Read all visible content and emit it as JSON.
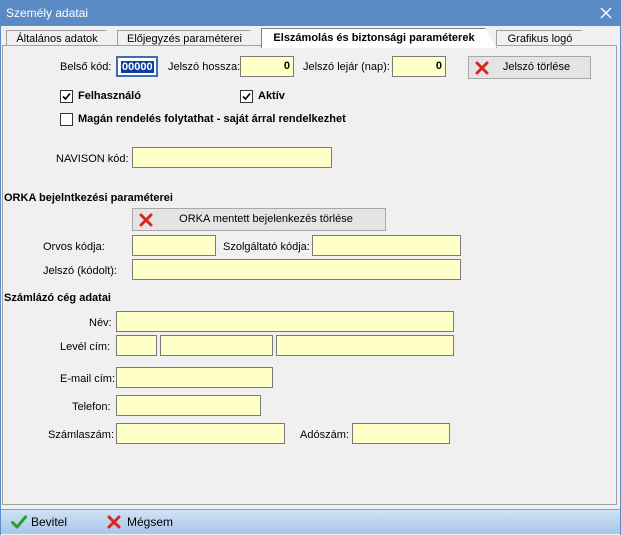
{
  "window": {
    "title": "Személy adatai"
  },
  "tabs": [
    {
      "label": "Általános adatok"
    },
    {
      "label": "Előjegyzés paraméterei"
    },
    {
      "label": "Elszámolás és biztonsági paraméterek"
    },
    {
      "label": "Grafikus logó"
    }
  ],
  "security": {
    "belso_kod_label": "Belső kód:",
    "belso_kod_value": "00000",
    "jelszo_hossza_label": "Jelszó hossza:",
    "jelszo_hossza_value": "0",
    "jelszo_lejar_label": "Jelszó lejár (nap):",
    "jelszo_lejar_value": "0",
    "jelszo_torlese_label": "Jelszó törlése",
    "felhasznalo_label": "Felhasználó",
    "felhasznalo_checked": true,
    "aktiv_label": "Aktív",
    "aktiv_checked": true,
    "magan_label": "Magán rendelés folytathat - saját árral rendelkezhet",
    "magan_checked": false,
    "navison_label": "NAVISON kód:",
    "navison_value": ""
  },
  "orka": {
    "section_title": "ORKA bejelntkezési paraméterei",
    "torles_label": "ORKA mentett bejelenkezés törlése",
    "orvos_kodja_label": "Orvos kódja:",
    "orvos_kodja_value": "",
    "szolgaltato_kodja_label": "Szolgáltató kódja:",
    "szolgaltato_kodja_value": "",
    "jelszo_kodolt_label": "Jelszó (kódolt):",
    "jelszo_kodolt_value": ""
  },
  "billing": {
    "section_title": "Számlázó cég adatai",
    "nev_label": "Név:",
    "nev_value": "",
    "level_cim_label": "Levél cím:",
    "level_cim_zip": "",
    "level_cim_city": "",
    "level_cim_street": "",
    "email_label": "E-mail cím:",
    "email_value": "",
    "telefon_label": "Telefon:",
    "telefon_value": "",
    "szamlaszam_label": "Számlaszám:",
    "szamlaszam_value": "",
    "adoszam_label": "Adószám:",
    "adoszam_value": ""
  },
  "footer": {
    "ok_label": "Bevitel",
    "cancel_label": "Mégsem"
  },
  "colors": {
    "titlebar": "#5b8bc5",
    "input_bg": "#ffffc8",
    "cancel_red": "#d9261c",
    "ok_green": "#2e9e2e"
  }
}
